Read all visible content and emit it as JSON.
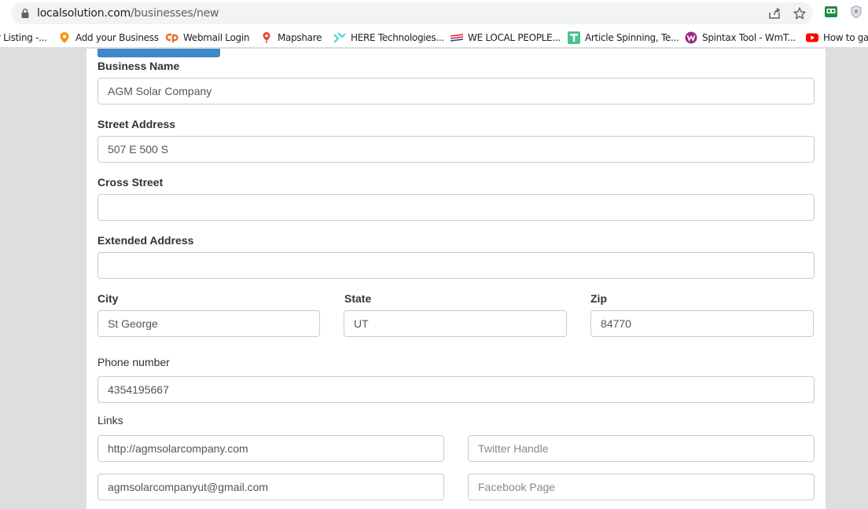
{
  "browser": {
    "url_domain": "localsolution.com",
    "url_path": "/businesses/new"
  },
  "bookmarks": [
    {
      "label": "r Listing -...",
      "icon": "none"
    },
    {
      "label": "Add your Business",
      "icon": "pin-badge-icon"
    },
    {
      "label": "Webmail Login",
      "icon": "cpanel-icon"
    },
    {
      "label": "Mapshare",
      "icon": "map-pin-icon"
    },
    {
      "label": "HERE Technologies...",
      "icon": "here-icon"
    },
    {
      "label": "WE LOCAL PEOPLE...",
      "icon": "stripes-icon"
    },
    {
      "label": "Article Spinning, Te...",
      "icon": "t-icon"
    },
    {
      "label": "Spintax Tool - WmT...",
      "icon": "w-circle-icon"
    },
    {
      "label": "How to ga",
      "icon": "youtube-icon"
    }
  ],
  "form": {
    "business_name": {
      "label": "Business Name",
      "value": "AGM Solar Company"
    },
    "street_address": {
      "label": "Street Address",
      "value": "507 E 500 S"
    },
    "cross_street": {
      "label": "Cross Street",
      "value": ""
    },
    "extended_address": {
      "label": "Extended Address",
      "value": ""
    },
    "city": {
      "label": "City",
      "value": "St George"
    },
    "state": {
      "label": "State",
      "value": "UT"
    },
    "zip": {
      "label": "Zip",
      "value": "84770"
    },
    "phone": {
      "label": "Phone number",
      "value": "4354195667"
    },
    "links": {
      "label": "Links",
      "website": {
        "value": "http://agmsolarcompany.com",
        "placeholder": ""
      },
      "twitter": {
        "value": "",
        "placeholder": "Twitter Handle"
      },
      "email": {
        "value": "agmsolarcompanyut@gmail.com",
        "placeholder": ""
      },
      "facebook": {
        "value": "",
        "placeholder": "Facebook Page"
      }
    }
  },
  "colors": {
    "accent_tab": "#3f88c7",
    "page_bg": "#dedede",
    "input_border": "#cccccc"
  }
}
